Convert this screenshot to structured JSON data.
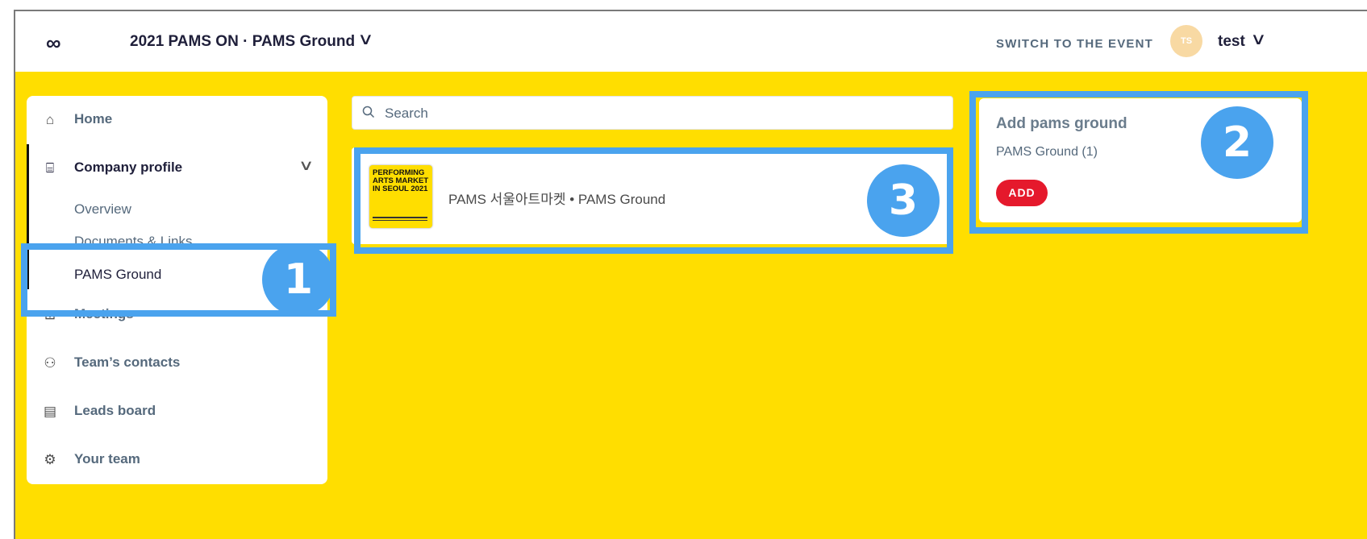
{
  "topbar": {
    "logo": "∞",
    "event_title": "2021 PAMS ON · PAMS Ground",
    "switch_label": "SWITCH TO THE EVENT",
    "avatar_initials": "TS",
    "username": "test"
  },
  "sidebar": {
    "items": [
      {
        "label": "Home",
        "icon": "home-icon"
      },
      {
        "label": "Company profile",
        "icon": "store-icon"
      },
      {
        "label": "Meetings",
        "icon": "meetings-icon"
      },
      {
        "label": "Team’s contacts",
        "icon": "contacts-icon"
      },
      {
        "label": "Leads board",
        "icon": "board-icon"
      },
      {
        "label": "Your team",
        "icon": "team-icon"
      }
    ],
    "sub_items": [
      "Overview",
      "Documents & Links",
      "PAMS Ground"
    ]
  },
  "search": {
    "placeholder": "Search"
  },
  "result": {
    "thumbnail_title": "PERFORMING ARTS MARKET IN SEOUL 2021",
    "text": "PAMS 서울아트마켓 • PAMS Ground"
  },
  "add_card": {
    "title": "Add pams ground",
    "subtitle": "PAMS Ground (1)",
    "button": "ADD"
  },
  "annotations": {
    "badge1": "1",
    "badge2": "2",
    "badge3": "3"
  },
  "colors": {
    "accent_yellow": "#ffde00",
    "highlight_blue": "#4aa3ee",
    "add_red": "#e5192c"
  }
}
